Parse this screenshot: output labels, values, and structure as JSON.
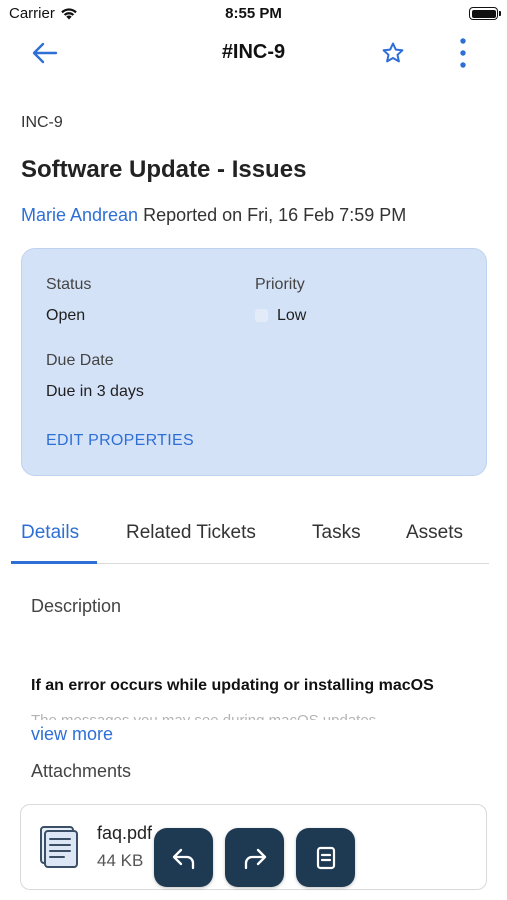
{
  "status_bar": {
    "carrier": "Carrier",
    "time": "8:55 PM",
    "wifi_icon": "wifi-icon",
    "battery_icon": "battery-icon"
  },
  "nav": {
    "title": "#INC-9",
    "back_icon": "arrow-left-icon",
    "star_icon": "star-outline-icon",
    "more_icon": "more-vertical-icon"
  },
  "ticket": {
    "id": "INC-9",
    "title": "Software Update - Issues",
    "reporter": "Marie Andrean",
    "reported_text": " Reported on Fri, 16 Feb 7:59 PM"
  },
  "properties": {
    "status_label": "Status",
    "status_value": "Open",
    "priority_label": "Priority",
    "priority_value": "Low",
    "due_label": "Due Date",
    "due_value": "Due in 3 days",
    "edit_label": "EDIT PROPERTIES"
  },
  "tabs": [
    {
      "label": "Details",
      "active": true
    },
    {
      "label": "Related Tickets",
      "active": false
    },
    {
      "label": "Tasks",
      "active": false
    },
    {
      "label": "Assets",
      "active": false
    }
  ],
  "details": {
    "description_label": "Description",
    "description_heading": "If an error occurs while updating or installing macOS",
    "description_faded": "The messages you may see during macOS updates",
    "view_more": "view more",
    "attachments_label": "Attachments"
  },
  "attachments": [
    {
      "name": "faq.pdf",
      "size": "44 KB",
      "icon": "document-file-icon"
    }
  ],
  "actions": [
    {
      "name": "reply-button",
      "icon": "reply-icon"
    },
    {
      "name": "forward-button",
      "icon": "forward-icon"
    },
    {
      "name": "notes-button",
      "icon": "note-icon"
    }
  ],
  "colors": {
    "accent": "#2e6fd6",
    "card_bg": "#d4e2f8",
    "fab_bg": "#1e3a52"
  }
}
